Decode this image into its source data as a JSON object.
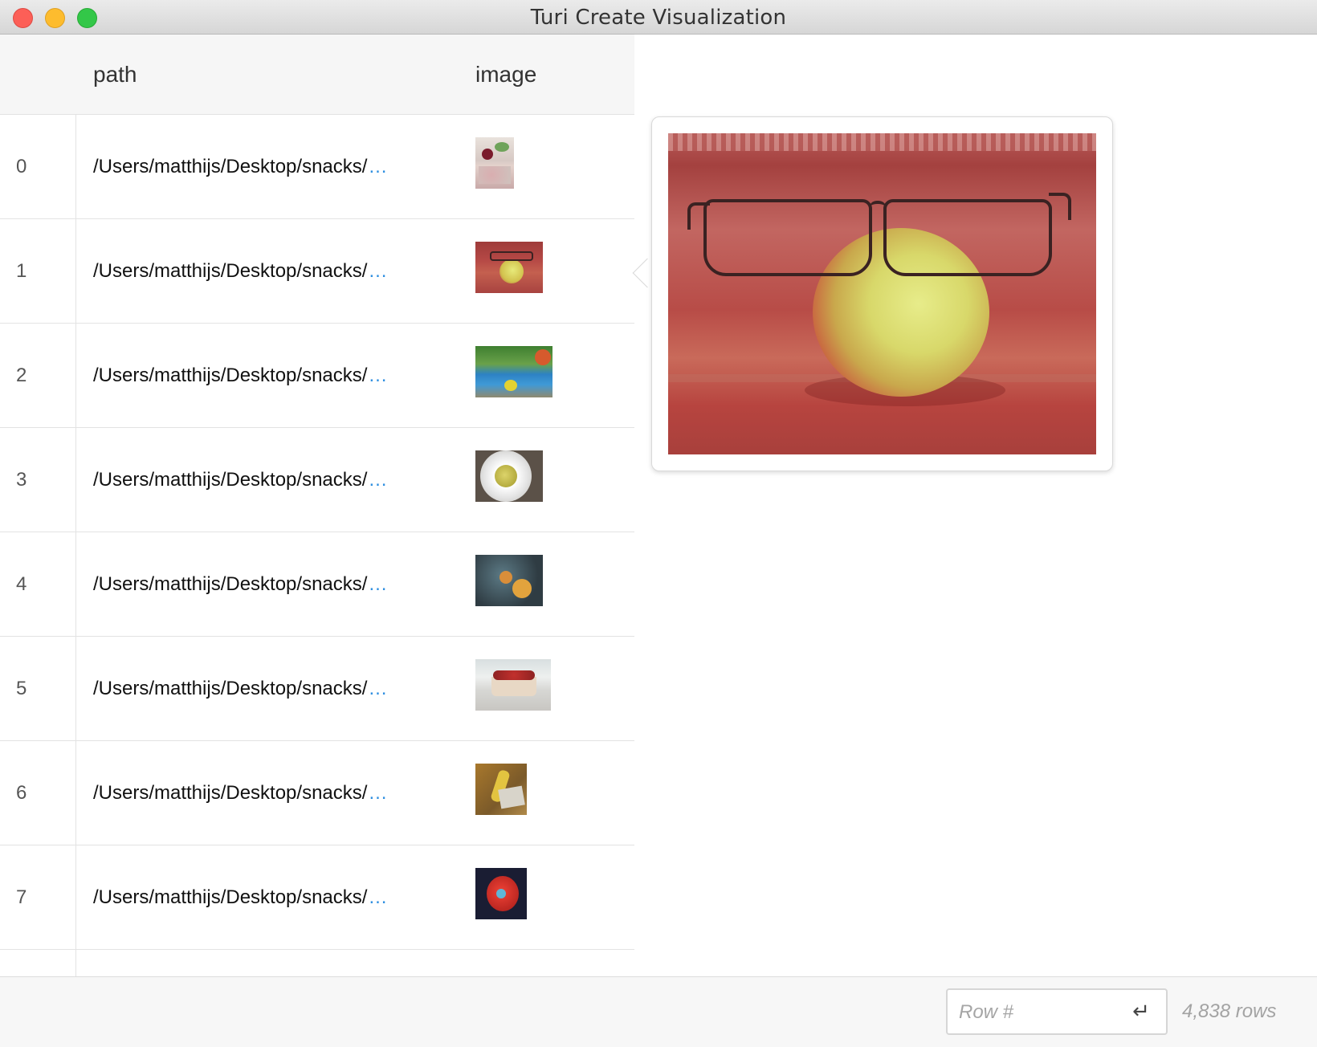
{
  "window": {
    "title": "Turi Create Visualization"
  },
  "table": {
    "columns": {
      "path": "path",
      "image": "image"
    },
    "ellipsis": "...",
    "rows": [
      {
        "index": "0",
        "path": "/Users/matthijs/Desktop/snacks/"
      },
      {
        "index": "1",
        "path": "/Users/matthijs/Desktop/snacks/"
      },
      {
        "index": "2",
        "path": "/Users/matthijs/Desktop/snacks/"
      },
      {
        "index": "3",
        "path": "/Users/matthijs/Desktop/snacks/"
      },
      {
        "index": "4",
        "path": "/Users/matthijs/Desktop/snacks/"
      },
      {
        "index": "5",
        "path": "/Users/matthijs/Desktop/snacks/"
      },
      {
        "index": "6",
        "path": "/Users/matthijs/Desktop/snacks/"
      },
      {
        "index": "7",
        "path": "/Users/matthijs/Desktop/snacks/"
      }
    ]
  },
  "footer": {
    "row_input_placeholder": "Row #",
    "enter_icon": "return-arrow-icon",
    "enter_glyph": "↵",
    "row_count": "4,838 rows"
  },
  "colors": {
    "link_ellipsis": "#2f8fe0",
    "close": "#fc5f57",
    "minimize": "#fdbc2e",
    "maximize": "#33c748"
  }
}
